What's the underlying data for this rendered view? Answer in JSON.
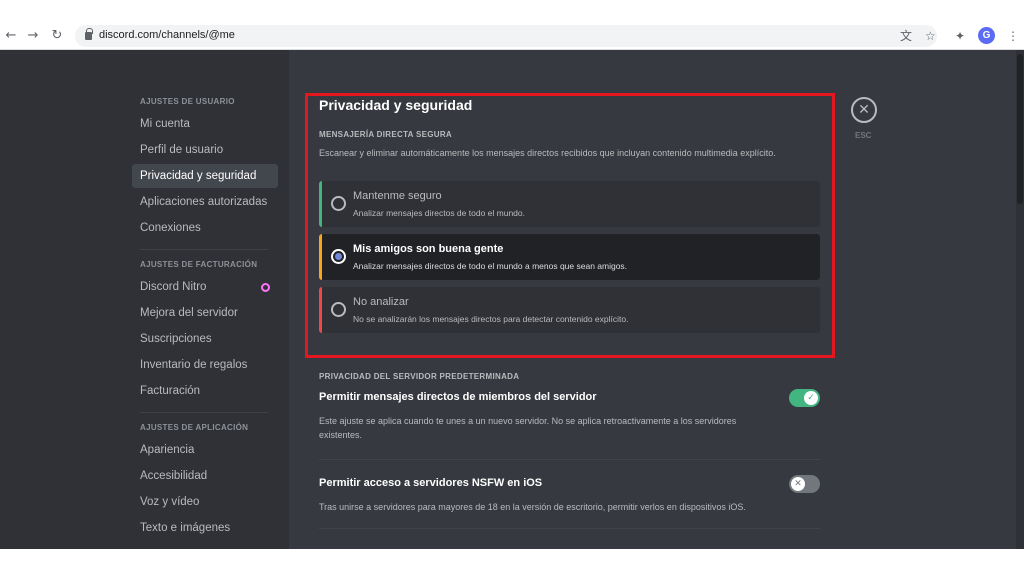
{
  "browser": {
    "url": "discord.com/channels/@me",
    "back_icon": "←",
    "forward_icon": "→",
    "reload_icon": "↻",
    "translate_icon": "文",
    "star_icon": "☆",
    "extensions_icon": "✦",
    "avatar_letter": "G",
    "menu_icon": "⋮"
  },
  "sidebar": {
    "sections": [
      {
        "header": "AJUSTES DE USUARIO",
        "items": [
          "Mi cuenta",
          "Perfil de usuario",
          "Privacidad y seguridad",
          "Aplicaciones autorizadas",
          "Conexiones"
        ]
      },
      {
        "header": "AJUSTES DE FACTURACIÓN",
        "items": [
          "Discord Nitro",
          "Mejora del servidor",
          "Suscripciones",
          "Inventario de regalos",
          "Facturación"
        ]
      },
      {
        "header": "AJUSTES DE APLICACIÓN",
        "items": [
          "Apariencia",
          "Accesibilidad",
          "Voz y vídeo",
          "Texto e imágenes"
        ]
      }
    ],
    "active_item": "Privacidad y seguridad"
  },
  "main": {
    "title": "Privacidad y seguridad",
    "safe_dm": {
      "header": "MENSAJERÍA DIRECTA SEGURA",
      "description": "Escanear y eliminar automáticamente los mensajes directos recibidos que incluyan contenido multimedia explícito.",
      "options": [
        {
          "title": "Mantenme seguro",
          "description": "Analizar mensajes directos de todo el mundo.",
          "selected": false,
          "color": "#43b581"
        },
        {
          "title": "Mis amigos son buena gente",
          "description": "Analizar mensajes directos de todo el mundo a menos que sean amigos.",
          "selected": true,
          "color": "#faa61a"
        },
        {
          "title": "No analizar",
          "description": "No se analizarán los mensajes directos para detectar contenido explícito.",
          "selected": false,
          "color": "#f04747"
        }
      ]
    },
    "server_privacy": {
      "header": "PRIVACIDAD DEL SERVIDOR PREDETERMINADA",
      "allow_dm_title": "Permitir mensajes directos de miembros del servidor",
      "allow_dm_desc": "Este ajuste se aplica cuando te unes a un nuevo servidor. No se aplica retroactivamente a los servidores existentes.",
      "allow_dm_on": true,
      "nsfw_title": "Permitir acceso a servidores NSFW en iOS",
      "nsfw_desc": "Tras unirse a servidores para mayores de 18 en la versión de escritorio, permitir verlos en dispositivos iOS.",
      "nsfw_on": false
    },
    "close": {
      "icon": "✕",
      "label": "ESC"
    }
  },
  "colors": {
    "toggle_on": "#43b581",
    "toggle_off": "#72767d",
    "highlight": "#e3171d",
    "accent": "#7289da"
  }
}
